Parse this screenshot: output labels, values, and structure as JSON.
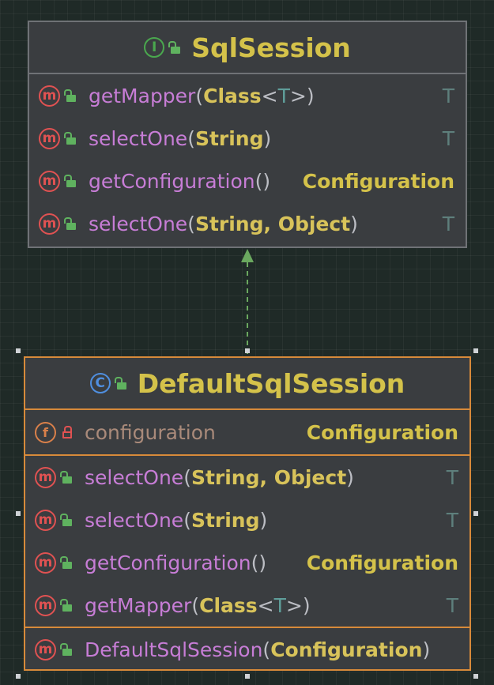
{
  "interface_box": {
    "kind": "I",
    "title": "SqlSession",
    "methods": [
      {
        "name": "getMapper",
        "p1": "Class",
        "p2": "T",
        "ret": "T"
      },
      {
        "name": "selectOne",
        "p1": "String",
        "ret": "T"
      },
      {
        "name": "getConfiguration",
        "ret": "Configuration"
      },
      {
        "name": "selectOne",
        "p1": "String, Object",
        "ret": "T"
      }
    ]
  },
  "class_box": {
    "kind": "C",
    "title": "DefaultSqlSession",
    "field": {
      "kind": "f",
      "name": "configuration",
      "type": "Configuration"
    },
    "methods": [
      {
        "name": "selectOne",
        "p1": "String, Object",
        "ret": "T"
      },
      {
        "name": "selectOne",
        "p1": "String",
        "ret": "T"
      },
      {
        "name": "getConfiguration",
        "ret": "Configuration"
      },
      {
        "name": "getMapper",
        "p1": "Class",
        "p2": "T",
        "ret": "T"
      }
    ],
    "constructor": {
      "name": "DefaultSqlSession",
      "p1": "Configuration"
    }
  },
  "method_icon": "m",
  "colors": {
    "interface_accent": "#4aa84e",
    "class_accent": "#4f8fe0",
    "selection": "#d78a3a"
  }
}
